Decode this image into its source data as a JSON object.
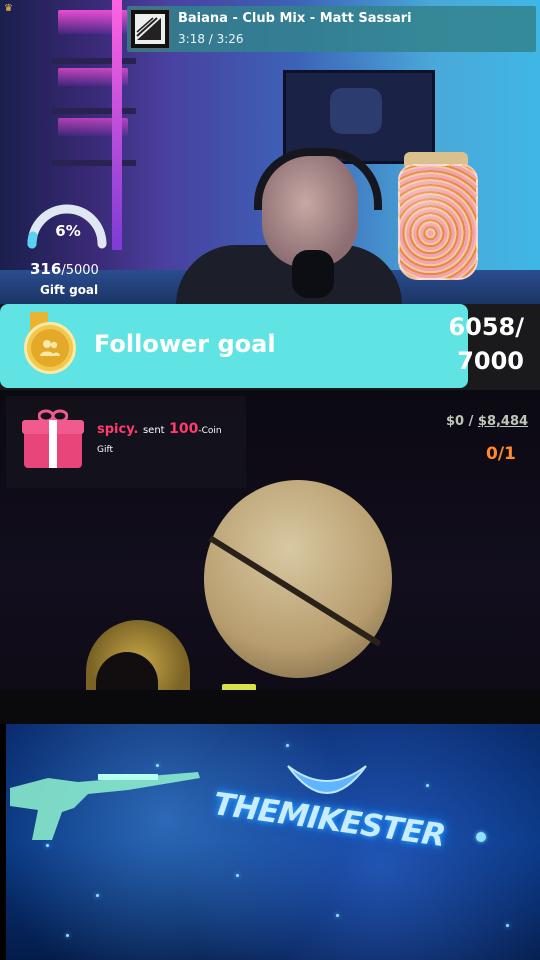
{
  "stream_badge": {
    "icon": "crown-icon"
  },
  "now_playing": {
    "title": "Baiana - Club Mix - Matt Sassari",
    "time": "3:18 / 3:26"
  },
  "gift_goal": {
    "percent_label": "6%",
    "percent": 0.06,
    "current": "316",
    "target": "/5000",
    "label": "Gift goal"
  },
  "follower_goal": {
    "label": "Follower goal",
    "current": "6058/",
    "target": "7000",
    "icon": "users-icon"
  },
  "gift_alert": {
    "user": "spicy.",
    "sent_text": "sent",
    "amount": "100",
    "coin_text": "-Coin",
    "gift_text": "Gift",
    "icon": "gift-icon"
  },
  "game_hud": {
    "money_current": "$0",
    "money_sep": "/",
    "money_total": "$8,484",
    "ammo": "0/1"
  },
  "banner": {
    "brand": "THEMIKESTER"
  },
  "colors": {
    "follower_bar": "#5fe3e3",
    "gift_accent": "#ff3b6b",
    "now_playing_bg": "#3282a0",
    "ammo": "#ff8a2b"
  }
}
